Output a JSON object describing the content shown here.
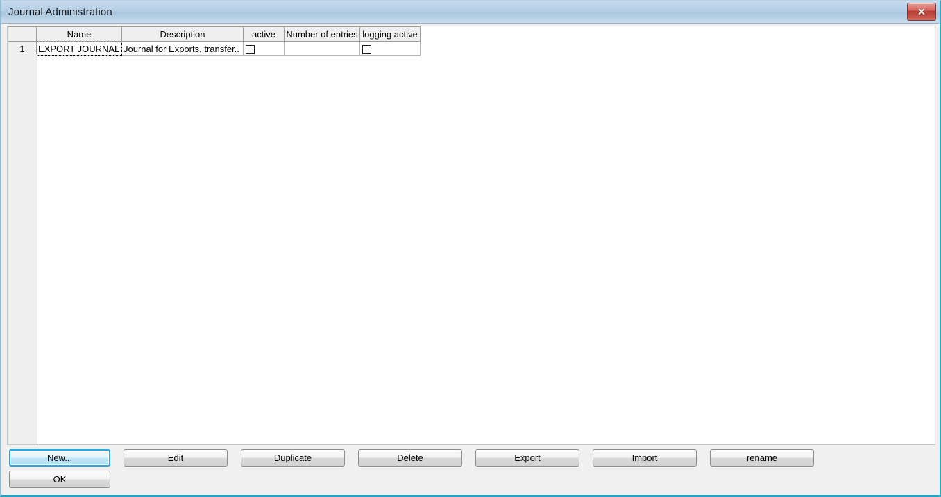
{
  "window": {
    "title": "Journal Administration",
    "close_label": "✕",
    "close_icon": "close-icon"
  },
  "table": {
    "columns": [
      {
        "key": "rownum",
        "label": ""
      },
      {
        "key": "name",
        "label": "Name"
      },
      {
        "key": "description",
        "label": "Description"
      },
      {
        "key": "active",
        "label": "active"
      },
      {
        "key": "entries",
        "label": "Number of entries"
      },
      {
        "key": "logging",
        "label": "logging active"
      }
    ],
    "rows": [
      {
        "rownum": "1",
        "name": "EXPORT JOURNAL",
        "description": "Journal for Exports, transfer..",
        "active": false,
        "entries": "",
        "logging": false
      }
    ]
  },
  "buttons": {
    "row1": [
      {
        "id": "new",
        "label": "New...",
        "focused": true
      },
      {
        "id": "edit",
        "label": "Edit",
        "focused": false
      },
      {
        "id": "duplicate",
        "label": "Duplicate",
        "focused": false
      },
      {
        "id": "delete",
        "label": "Delete",
        "focused": false
      },
      {
        "id": "export",
        "label": "Export",
        "focused": false
      },
      {
        "id": "import",
        "label": "Import",
        "focused": false
      },
      {
        "id": "rename",
        "label": "rename",
        "focused": false
      }
    ],
    "row2": [
      {
        "id": "ok",
        "label": "OK",
        "focused": false
      }
    ]
  },
  "colors": {
    "titlebar_top": "#c4d9ec",
    "titlebar_bottom": "#c8dced",
    "close_red": "#b63c32",
    "focus_blue": "#28a8e0",
    "window_border": "#1fa3c4",
    "header_gray": "#efefef"
  }
}
